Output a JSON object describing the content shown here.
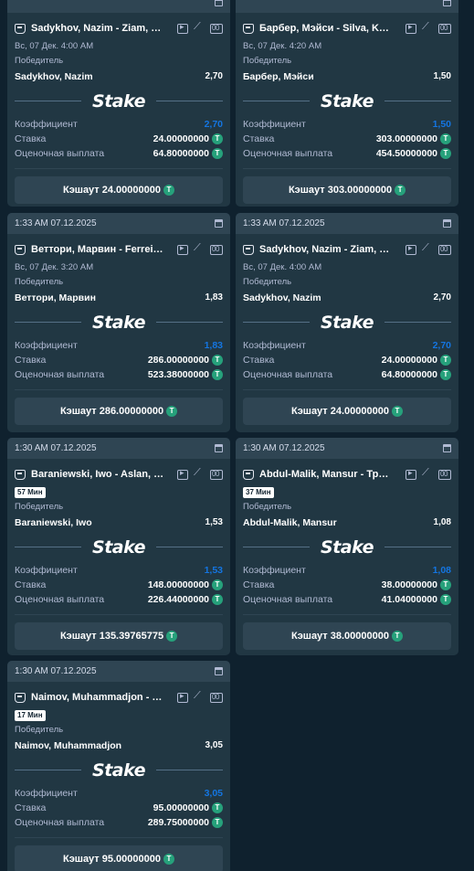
{
  "labels": {
    "market": "Победитель",
    "odds": "Коэффициент",
    "stake": "Ставка",
    "payout": "Оценочная выплата",
    "brand": "Stake",
    "coin": "T"
  },
  "cards": [
    {
      "header_time": "",
      "match": "Sadykhov, Nazim - Ziam, Far...",
      "date": "Вс, 07 Дек.  4:00 AM",
      "live": "",
      "outcome": "Sadykhov, Nazim",
      "odds": "2,70",
      "stake": "24.00000000",
      "payout": "64.80000000",
      "cashout": "Кэшаут 24.00000000"
    },
    {
      "header_time": "",
      "match": "Барбер, Мэйси - Silva, Karine",
      "date": "Вс, 07 Дек.  4:20 AM",
      "live": "",
      "outcome": "Барбер, Мэйси",
      "odds": "1,50",
      "stake": "303.00000000",
      "payout": "454.50000000",
      "cashout": "Кэшаут 303.00000000"
    },
    {
      "header_time": "1:33 AM 07.12.2025",
      "match": "Веттори, Марвин - Ferreira, ...",
      "date": "Вс, 07 Дек.  3:20 AM",
      "live": "",
      "outcome": "Веттори, Марвин",
      "odds": "1,83",
      "stake": "286.00000000",
      "payout": "523.38000000",
      "cashout": "Кэшаут 286.00000000"
    },
    {
      "header_time": "1:33 AM 07.12.2025",
      "match": "Sadykhov, Nazim - Ziam, Far...",
      "date": "Вс, 07 Дек.  4:00 AM",
      "live": "",
      "outcome": "Sadykhov, Nazim",
      "odds": "2,70",
      "stake": "24.00000000",
      "payout": "64.80000000",
      "cashout": "Кэшаут 24.00000000"
    },
    {
      "header_time": "1:30 AM 07.12.2025",
      "match": "Baraniewski, Iwo - Aslan, Ibo",
      "date": "",
      "live": "57 Мин",
      "outcome": "Baraniewski, Iwo",
      "odds": "1,53",
      "stake": "148.00000000",
      "payout": "226.44000000",
      "cashout": "Кэшаут 135.39765775"
    },
    {
      "header_time": "1:30 AM 07.12.2025",
      "match": "Abdul-Malik, Mansur - Троко...",
      "date": "",
      "live": "37 Мин",
      "outcome": "Abdul-Malik, Mansur",
      "odds": "1,08",
      "stake": "38.00000000",
      "payout": "41.04000000",
      "cashout": "Кэшаут 38.00000000"
    },
    {
      "header_time": "1:30 AM 07.12.2025",
      "match": "Naimov, Muhammadjon - Sa...",
      "date": "",
      "live": "17 Мин",
      "outcome": "Naimov, Muhammadjon",
      "odds": "3,05",
      "stake": "95.00000000",
      "payout": "289.75000000",
      "cashout": "Кэшаут 95.00000000"
    }
  ]
}
